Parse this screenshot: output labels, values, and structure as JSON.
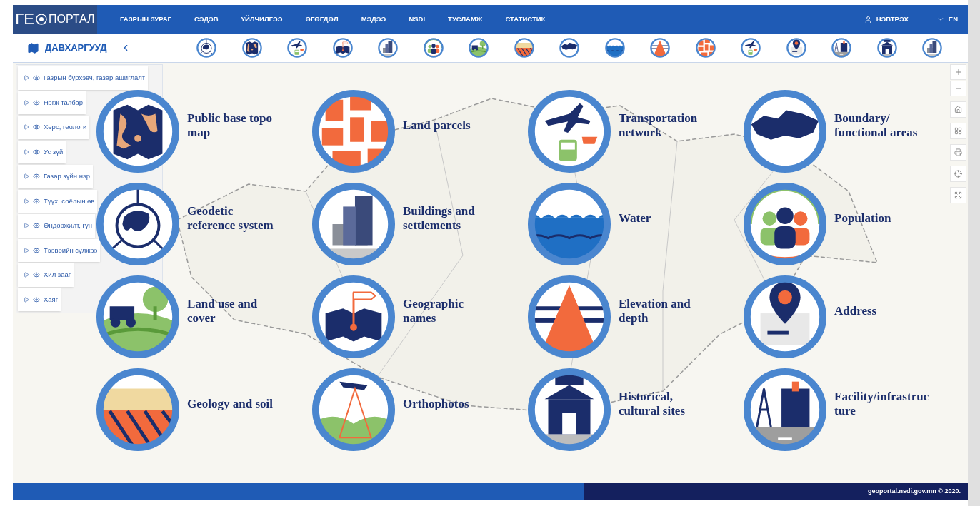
{
  "header": {
    "logo_left": "ГЕ",
    "logo_right": "ПОРТАЛ",
    "nav": [
      "ГАЗРЫН ЗУРАГ",
      "СЭДЭВ",
      "ҮЙЛЧИЛГЭЭ",
      "ӨГӨГДӨЛ",
      "МЭДЭЭ",
      "NSDI",
      "ТУСЛАМЖ",
      "СТАТИСТИК"
    ],
    "login": "НЭВТРЭХ",
    "language": "EN"
  },
  "layers_bar": {
    "title": "ДАВХАРГУУД"
  },
  "layers": [
    {
      "label": "Газрын бүрхэвч, газар ашиглалт",
      "expanded": false,
      "visible": true
    },
    {
      "label": "Нэгж талбар",
      "expanded": false,
      "visible": true
    },
    {
      "label": "Хөрс, геологи",
      "expanded": false,
      "visible": true
    },
    {
      "label": "Ус зүй",
      "expanded": false,
      "visible": true
    },
    {
      "label": "Газар зүйн нэр",
      "expanded": false,
      "visible": true
    },
    {
      "label": "Түүх, соёлын өв",
      "expanded": false,
      "visible": true
    },
    {
      "label": "Өндөржилт, гүн",
      "expanded": false,
      "visible": true
    },
    {
      "label": "Тээврийн сүлжээ",
      "expanded": false,
      "visible": true
    },
    {
      "label": "Хил зааг",
      "expanded": false,
      "visible": true
    },
    {
      "label": "Хаяг",
      "expanded": false,
      "visible": true
    }
  ],
  "themes": [
    {
      "lines": [
        "Public base topo",
        "map"
      ]
    },
    {
      "lines": [
        "Land parcels"
      ]
    },
    {
      "lines": [
        "Transportation",
        "network"
      ]
    },
    {
      "lines": [
        "Boundary/",
        "functional areas"
      ]
    },
    {
      "lines": [
        "Geodetic",
        "reference system"
      ]
    },
    {
      "lines": [
        "Buildings and",
        "settlements"
      ]
    },
    {
      "lines": [
        "Water"
      ]
    },
    {
      "lines": [
        "Population"
      ]
    },
    {
      "lines": [
        "Land use and",
        "cover"
      ]
    },
    {
      "lines": [
        "Geographic",
        "names"
      ]
    },
    {
      "lines": [
        "Elevation and",
        "depth"
      ]
    },
    {
      "lines": [
        "Address"
      ]
    },
    {
      "lines": [
        "Geology and soil"
      ]
    },
    {
      "lines": [
        "Orthophotos"
      ]
    },
    {
      "lines": [
        "Historical,",
        "cultural sites"
      ]
    },
    {
      "lines": [
        "Facility/infrastruc",
        "ture"
      ]
    }
  ],
  "footer": {
    "copyright": "geoportal.nsdi.gov.mn © 2020."
  }
}
